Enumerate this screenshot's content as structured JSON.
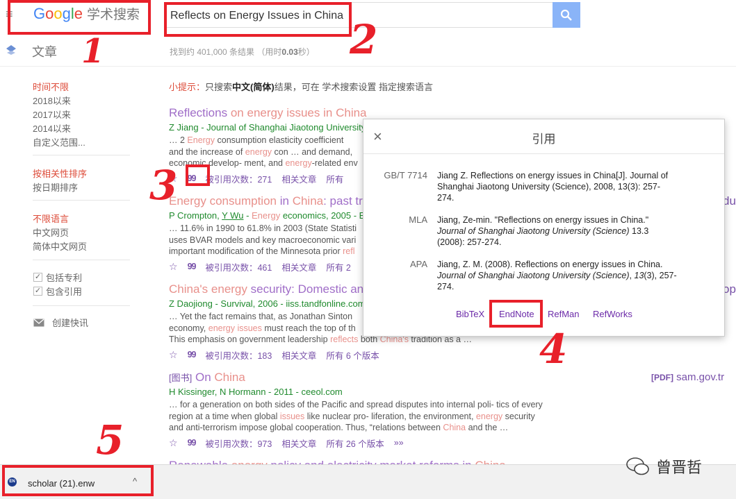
{
  "header": {
    "logo": {
      "g": "G",
      "o1": "o",
      "o2": "o",
      "g2": "g",
      "l": "l",
      "e": "e",
      "suffix": "学术搜索"
    },
    "search_value": "Reflects on Energy Issues in China",
    "search_icon": "search-icon",
    "menu_icon": "≡"
  },
  "subheader": {
    "mode_label": "文章",
    "stats_prefix": "找到约 401,000 条结果",
    "stats_time": "（用时",
    "stats_secs": "0.03",
    "stats_suffix": "秒）"
  },
  "sidebar": {
    "time": [
      "时间不限",
      "2018以来",
      "2017以来",
      "2014以来",
      "自定义范围..."
    ],
    "sort": [
      "按相关性排序",
      "按日期排序"
    ],
    "lang": [
      "不限语言",
      "中文网页",
      "简体中文网页"
    ],
    "checks": [
      "包括专利",
      "包含引用"
    ],
    "alert": "创建快讯"
  },
  "tip": {
    "label": "小提示：",
    "pre": "只搜索",
    "bold": "中文(简体)",
    "mid": "结果，可在",
    "link1": "学术搜索设置",
    "link2": "指定搜索语言"
  },
  "results": [
    {
      "title_a": "Reflections",
      "title_b": "on",
      "title_c": "energy issues",
      "title_d": "in",
      "title_e": "China",
      "meta": "Z Jiang - Journal of Shanghai Jiaotong University",
      "snippet_1": "… 2 ",
      "snippet_2": "Energy",
      "snippet_3": " consumption elasticity coefficient ",
      "snippet_line2_a": "and the increase of ",
      "snippet_line2_b": "energy",
      "snippet_line2_c": " con … and demand,",
      "snippet_line3_a": "economic develop- ment, and ",
      "snippet_line3_b": "energy",
      "snippet_line3_c": "-related env",
      "cited": "被引用次数：271",
      "related": "相关文章",
      "versions": "所有"
    },
    {
      "title_a": "Energy consumption",
      "title_b": "in",
      "title_c": "China",
      "title_d": ": past tr",
      "meta_a": "P Crompton, ",
      "meta_b": "Y Wu",
      "meta_c": " - ",
      "meta_d": "Energy",
      "meta_e": " economics, 2005 - E",
      "snippet_1": "… 11.6% in 1990 to 61.8% in 2003 (State Statisti",
      "snippet_2": "uses BVAR models and key macroeconomic vari",
      "snippet_3": "important modification of the Minnesota prior ",
      "snippet_4": "refl",
      "cited": "被引用次数：461",
      "related": "相关文章",
      "versions": "所有 2",
      "side": "du"
    },
    {
      "title_a": "China's",
      "title_b": "energy",
      "title_c": " security: Domestic an",
      "meta": "Z Daojiong - Survival, 2006 - iiss.tandfonline.com",
      "snippet_1": "… Yet the fact remains that, as Jonathan Sinton",
      "snippet_2a": "economy, ",
      "snippet_2b": "energy issues",
      "snippet_2c": " must reach the top of th",
      "snippet_3a": "This emphasis on government leadership ",
      "snippet_3b": "reflects",
      "snippet_3c": " both ",
      "snippet_3d": "China's",
      "snippet_3e": " tradition as a …",
      "cited": "被引用次数：183",
      "related": "相关文章",
      "versions": "所有 6 个版本",
      "side": "op"
    },
    {
      "tag": "[图书]",
      "title_a": "On",
      "title_b": "China",
      "meta": "H Kissinger, N Hormann - 2011 - ceeol.com",
      "snippet_1": "… for a generation on both sides of the Pacific and spread disputes into internal poli- tics of every",
      "snippet_2a": "region at a time when global ",
      "snippet_2b": "issues",
      "snippet_2c": " like nuclear pro- liferation, the environment, ",
      "snippet_2d": "energy",
      "snippet_2e": " security",
      "snippet_3a": "and anti-terrorism impose global cooperation. Thus, “relations between ",
      "snippet_3b": "China",
      "snippet_3c": " and the …",
      "cited": "被引用次数：973",
      "related": "相关文章",
      "versions": "所有 26 个版本",
      "more": "»»",
      "pdf_label": "[PDF]",
      "pdf_source": "sam.gov.tr"
    },
    {
      "title_a": "Renewable",
      "title_b": "energy",
      "title_c": " policy and electricity market reforms in ",
      "title_d": "China"
    }
  ],
  "dialog": {
    "title": "引用",
    "close": "×",
    "citations": [
      {
        "format": "GB/T 7714",
        "line1": "Jiang Z. Reflections on energy issues in China[J]. Journal of",
        "line2": "Shanghai Jiaotong University (Science), 2008, 13(3): 257-",
        "line3": "274."
      },
      {
        "format": "MLA",
        "line1": "Jiang, Ze-min. \"Reflections on energy issues in China.\"",
        "line2": "Journal of Shanghai Jiaotong University (Science)",
        "line2b": " 13.3",
        "line3": "(2008): 257-274."
      },
      {
        "format": "APA",
        "line1": "Jiang, Z. M. (2008). Reflections on energy issues in China.",
        "line2": "Journal of Shanghai Jiaotong University (Science)",
        "line2b": ", ",
        "line2c": "13",
        "line2d": "(3), 257-",
        "line3": "274."
      }
    ],
    "links": [
      "BibTeX",
      "EndNote",
      "RefMan",
      "RefWorks"
    ]
  },
  "download": {
    "file": "scholar (21).enw",
    "icon_text": "EN",
    "chevron": "^"
  },
  "watermark": "曾晋哲",
  "annotations": [
    "1",
    "2",
    "3",
    "4",
    "5"
  ],
  "colors": {
    "annotation": "#e8202a",
    "link": "#7851a9",
    "highlight": "#e8908b",
    "source": "#1f8a2d"
  }
}
